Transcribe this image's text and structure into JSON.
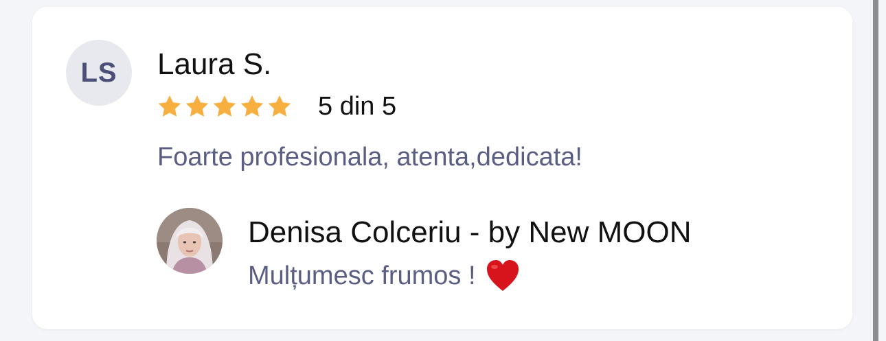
{
  "review": {
    "initials": "LS",
    "name": "Laura S.",
    "rating": 5,
    "rating_max": 5,
    "rating_text": "5 din 5",
    "text": "Foarte profesionala, atenta,dedicata!"
  },
  "reply": {
    "owner_name": "Denisa Colceriu - by New MOON",
    "text": "Mulțumesc frumos !",
    "emoji_icon": "heart-icon"
  },
  "colors": {
    "star": "#f7b040",
    "heart": "#d7141b",
    "text_muted": "#5a5e82",
    "avatar_bg": "#e7e9ef",
    "avatar_text": "#4b4f78"
  }
}
